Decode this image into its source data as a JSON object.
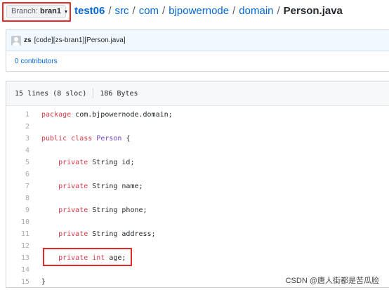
{
  "branch": {
    "label": "Branch:",
    "name": "bran1",
    "caret": "▾"
  },
  "breadcrumb": {
    "items": [
      "test06",
      "src",
      "com",
      "bjpowernode",
      "domain"
    ],
    "final": "Person.java",
    "separator": "/"
  },
  "commit": {
    "author": "zs",
    "message": "[code][zs-bran1][Person.java]"
  },
  "contributors": {
    "count": "0",
    "label": "contributors"
  },
  "file": {
    "lines": "15 lines (8 sloc)",
    "size": "186 Bytes"
  },
  "code": [
    {
      "n": "1",
      "text": "package com.bjpowernode.domain;"
    },
    {
      "n": "2",
      "text": ""
    },
    {
      "n": "3",
      "text": "public class Person {"
    },
    {
      "n": "4",
      "text": ""
    },
    {
      "n": "5",
      "text": "    private String id;"
    },
    {
      "n": "6",
      "text": ""
    },
    {
      "n": "7",
      "text": "    private String name;"
    },
    {
      "n": "8",
      "text": ""
    },
    {
      "n": "9",
      "text": "    private String phone;"
    },
    {
      "n": "10",
      "text": ""
    },
    {
      "n": "11",
      "text": "    private String address;"
    },
    {
      "n": "12",
      "text": ""
    },
    {
      "n": "13",
      "text": "    private int age;"
    },
    {
      "n": "14",
      "text": ""
    },
    {
      "n": "15",
      "text": "}"
    }
  ],
  "watermark": "CSDN @唐人街都是苦瓜脸",
  "colors": {
    "highlight": "#e8292a",
    "link": "#0366d6",
    "keyword": "#d73a49",
    "class": "#6f42c1"
  }
}
